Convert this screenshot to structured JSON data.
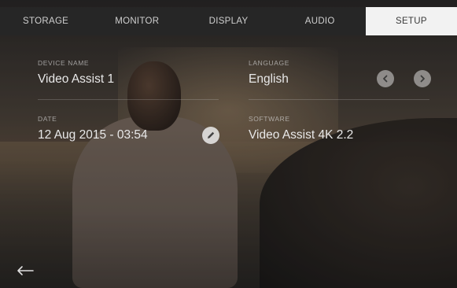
{
  "tabs": [
    {
      "label": "STORAGE",
      "active": false
    },
    {
      "label": "MONITOR",
      "active": false
    },
    {
      "label": "DISPLAY",
      "active": false
    },
    {
      "label": "AUDIO",
      "active": false
    },
    {
      "label": "SETUP",
      "active": true
    }
  ],
  "setup": {
    "device_name": {
      "label": "DEVICE NAME",
      "value": "Video Assist 1"
    },
    "language": {
      "label": "LANGUAGE",
      "value": "English"
    },
    "date": {
      "label": "DATE",
      "value": "12 Aug 2015 - 03:54"
    },
    "software": {
      "label": "SOFTWARE",
      "value": "Video Assist 4K 2.2"
    }
  },
  "icons": {
    "language_prev": "chevron-left-icon",
    "language_next": "chevron-right-icon",
    "date_edit": "pencil-icon",
    "back": "arrow-left-icon"
  },
  "colors": {
    "active_tab_bg": "#f2f2f2",
    "tab_bar_bg": "#262626",
    "text": "#e8e8e8"
  }
}
